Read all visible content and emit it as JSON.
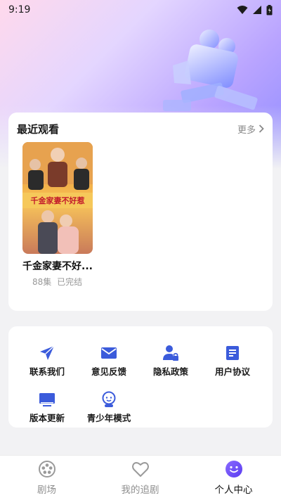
{
  "status_bar": {
    "time": "9:19"
  },
  "recent": {
    "title": "最近观看",
    "more_label": "更多",
    "items": [
      {
        "title": "千金家妻不好...",
        "episodes": "88集",
        "status": "已完结",
        "poster_text": "千金家妻不好惹"
      }
    ]
  },
  "tools": [
    {
      "label": "联系我们",
      "icon": "send-icon"
    },
    {
      "label": "意见反馈",
      "icon": "mail-icon"
    },
    {
      "label": "隐私政策",
      "icon": "user-lock-icon"
    },
    {
      "label": "用户协议",
      "icon": "document-icon"
    },
    {
      "label": "版本更新",
      "icon": "monitor-icon"
    },
    {
      "label": "青少年模式",
      "icon": "child-icon"
    }
  ],
  "tabbar": {
    "tabs": [
      {
        "label": "剧场",
        "icon": "film-reel-icon",
        "active": false
      },
      {
        "label": "我的追剧",
        "icon": "heart-icon",
        "active": false
      },
      {
        "label": "个人中心",
        "icon": "smiley-icon",
        "active": true
      }
    ]
  },
  "colors": {
    "accent": "#3b5bdb",
    "active_tab": "#6a55ff",
    "inactive": "#9a9a9a"
  }
}
